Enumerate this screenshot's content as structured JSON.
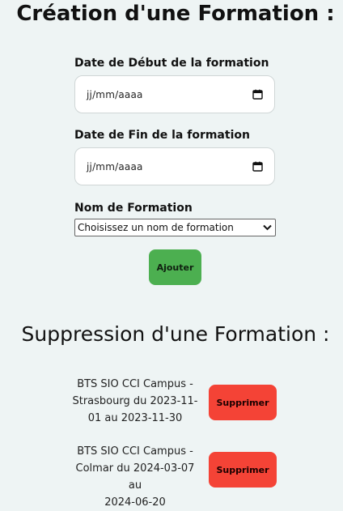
{
  "creation": {
    "title": "Création d'une Formation :",
    "start_date": {
      "label": "Date de Début de la formation",
      "value": "jj/mm/aaaa",
      "icon": "calendar-icon"
    },
    "end_date": {
      "label": "Date de Fin de la formation",
      "value": "jj/mm/aaaa",
      "icon": "calendar-icon"
    },
    "formation_name": {
      "label": "Nom de Formation",
      "selected": "Choisissez un nom de formation",
      "icon": "chevron-down-icon"
    },
    "add_button_label": "Ajouter",
    "add_button_color": "#4caf50"
  },
  "deletion": {
    "title": "Suppression d'une Formation :",
    "delete_button_color": "#f44336",
    "items": [
      {
        "line1": "BTS SIO CCI Campus -",
        "line2": "Strasbourg du 2023-11-",
        "line3": "01 au 2023-11-30",
        "button_label": "Supprimer"
      },
      {
        "line1": "BTS SIO CCI Campus -",
        "line2": "Colmar du 2024-03-07 au",
        "line3": "2024-06-20",
        "button_label": "Supprimer"
      }
    ]
  }
}
